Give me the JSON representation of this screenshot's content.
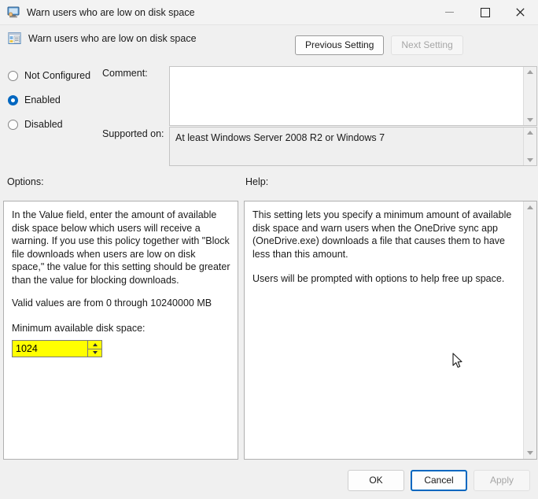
{
  "window": {
    "title": "Warn users who are low on disk space",
    "icon": "policy-monitor-icon",
    "controls": {
      "minimize": "minimize-icon",
      "maximize": "maximize-icon",
      "close": "close-icon"
    }
  },
  "setting_header": {
    "icon": "policy-setting-icon",
    "title": "Warn users who are low on disk space"
  },
  "nav": {
    "previous_label": "Previous Setting",
    "next_label": "Next Setting"
  },
  "state_options": [
    {
      "label": "Not Configured",
      "selected": false
    },
    {
      "label": "Enabled",
      "selected": true
    },
    {
      "label": "Disabled",
      "selected": false
    }
  ],
  "comment": {
    "label": "Comment:",
    "value": "",
    "placeholder": ""
  },
  "supported_on": {
    "label": "Supported on:",
    "value": "At least Windows Server 2008 R2 or Windows 7"
  },
  "options": {
    "label": "Options:",
    "description": "In the Value field, enter the amount of available disk space below which users will receive a warning. If you use this policy together with \"Block file downloads when users are low on disk space,\" the value for this setting should be greater than the value for blocking downloads.",
    "valid_values": "Valid values are from 0 through 10240000 MB",
    "field_label": "Minimum available disk space:",
    "field_value": "1024",
    "field_highlight_color": "#ffff00"
  },
  "help": {
    "label": "Help:",
    "paragraph1": "This setting lets you specify a minimum amount of available disk space and warn users when the OneDrive sync app (OneDrive.exe) downloads a file that causes them to have less than this amount.",
    "paragraph2": "Users will be prompted with options to help free up space."
  },
  "buttons": {
    "ok": "OK",
    "cancel": "Cancel",
    "apply": "Apply"
  },
  "colors": {
    "accent": "#0067c0",
    "dialog_background": "#f0f0f0",
    "highlight": "#ffff00"
  }
}
